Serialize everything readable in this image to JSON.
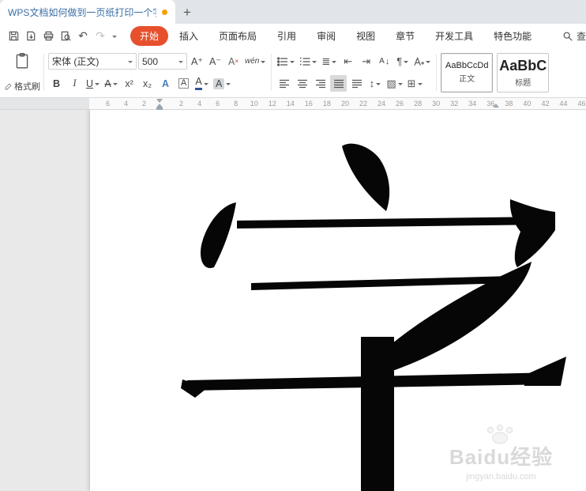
{
  "colors": {
    "accent": "#e7502d",
    "tab_title": "#3a6ea5",
    "unsaved_dot": "#f5a100",
    "font_color_bar": "#2f5496"
  },
  "titlebar": {
    "title": "WPS文档如何做到一页纸打印一个字",
    "new_tab": "+"
  },
  "quick_access": {
    "icons": [
      "save-icon",
      "export-icon",
      "print-icon",
      "print-preview-icon",
      "undo-icon",
      "redo-icon",
      "more-icon"
    ]
  },
  "icons": {
    "chevron": "▾",
    "undo": "↶",
    "redo": "↷",
    "pilcrow": "¶",
    "indent_decrease": "⇤",
    "indent_increase": "⇥",
    "line_spacing": "↕",
    "sort_letter": "A",
    "sort_arrow": "↓",
    "multilevel": "≣",
    "shading": "▨",
    "borders": "⊞"
  },
  "menu": {
    "tabs": [
      {
        "label": "开始",
        "active": true
      },
      {
        "label": "插入"
      },
      {
        "label": "页面布局"
      },
      {
        "label": "引用"
      },
      {
        "label": "审阅"
      },
      {
        "label": "视图"
      },
      {
        "label": "章节"
      },
      {
        "label": "开发工具"
      },
      {
        "label": "特色功能"
      }
    ],
    "search_label": "查"
  },
  "toolbar": {
    "format_painter_label": "格式刷",
    "font": {
      "name": "宋体 (正文)",
      "size": "500",
      "grow": "A⁺",
      "shrink": "A⁻",
      "clear": "A",
      "phonetic": "wén",
      "bold": "B",
      "italic": "I",
      "underline": "U",
      "strike": "A",
      "superscript": "x²",
      "subscript": "x₂",
      "effects": "A",
      "char_border": "A",
      "color": "A",
      "highlight": "A"
    },
    "styles": [
      {
        "preview": "AaBbCcDd",
        "label": "正文",
        "active": true
      },
      {
        "preview": "AaBbC",
        "label": "标题"
      }
    ]
  },
  "ruler": {
    "left_numbers": [
      "6",
      "4",
      "2"
    ],
    "numbers": [
      "2",
      "4",
      "6",
      "8",
      "10",
      "12",
      "14",
      "16",
      "18",
      "20",
      "22",
      "24",
      "26",
      "28",
      "30",
      "32",
      "34",
      "36",
      "38",
      "40",
      "42",
      "44",
      "46"
    ]
  },
  "document": {
    "character": "字",
    "watermark": {
      "text": "Baidu经验",
      "url": "jingyan.baidu.com"
    }
  }
}
